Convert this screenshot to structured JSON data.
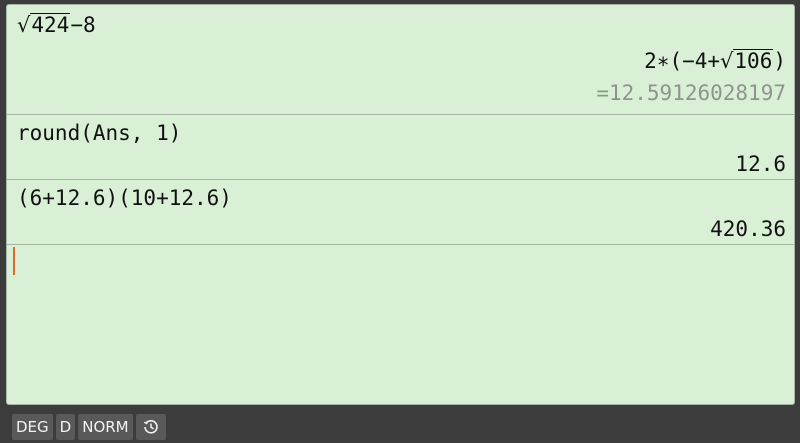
{
  "entries": [
    {
      "input_prefix_radicand": "424",
      "input_suffix": "−8",
      "result_coeff": "2∗(−4+",
      "result_radicand": "106",
      "result_close": ")",
      "decimal": "=12.59126028197"
    },
    {
      "input": "round(Ans, 1)",
      "result": "12.6"
    },
    {
      "input": "(6+12.6)(10+12.6)",
      "result": "420.36"
    }
  ],
  "status": {
    "angle_mode": "DEG",
    "display_mode": "D",
    "format_mode": "NORM",
    "history_icon": "history-icon"
  }
}
